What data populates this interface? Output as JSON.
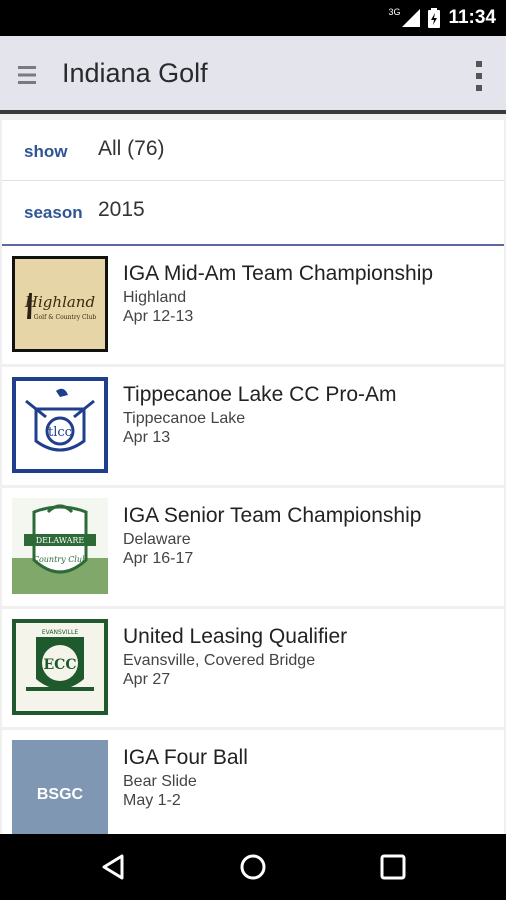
{
  "status_bar": {
    "time": "11:34",
    "network": "3G"
  },
  "app_bar": {
    "title": "Indiana Golf"
  },
  "filters": {
    "show": {
      "label": "show",
      "value": "All (76)"
    },
    "season": {
      "label": "season",
      "value": "2015"
    }
  },
  "events": [
    {
      "title": "IGA Mid-Am Team Championship",
      "location": "Highland",
      "date": "Apr 12-13",
      "logo_text": "Highland",
      "logo_sub": "Golf & Country Club"
    },
    {
      "title": "Tippecanoe Lake CC Pro-Am",
      "location": "Tippecanoe Lake",
      "date": "Apr 13",
      "logo_text": "tlcc"
    },
    {
      "title": "IGA Senior Team Championship",
      "location": "Delaware",
      "date": "Apr 16-17",
      "logo_text": "DELAWARE",
      "logo_sub": "Country Club"
    },
    {
      "title": "United Leasing Qualifier",
      "location": "Evansville, Covered Bridge",
      "date": "Apr 27",
      "logo_text": "ECC",
      "logo_sub": "EVANSVILLE"
    },
    {
      "title": "IGA Four Ball",
      "location": "Bear Slide",
      "date": "May 1-2",
      "logo_text": "BSGC"
    }
  ],
  "colors": {
    "accent": "#2f5597",
    "divider": "#5e6a9f",
    "app_bar": "#e4e4ec"
  }
}
